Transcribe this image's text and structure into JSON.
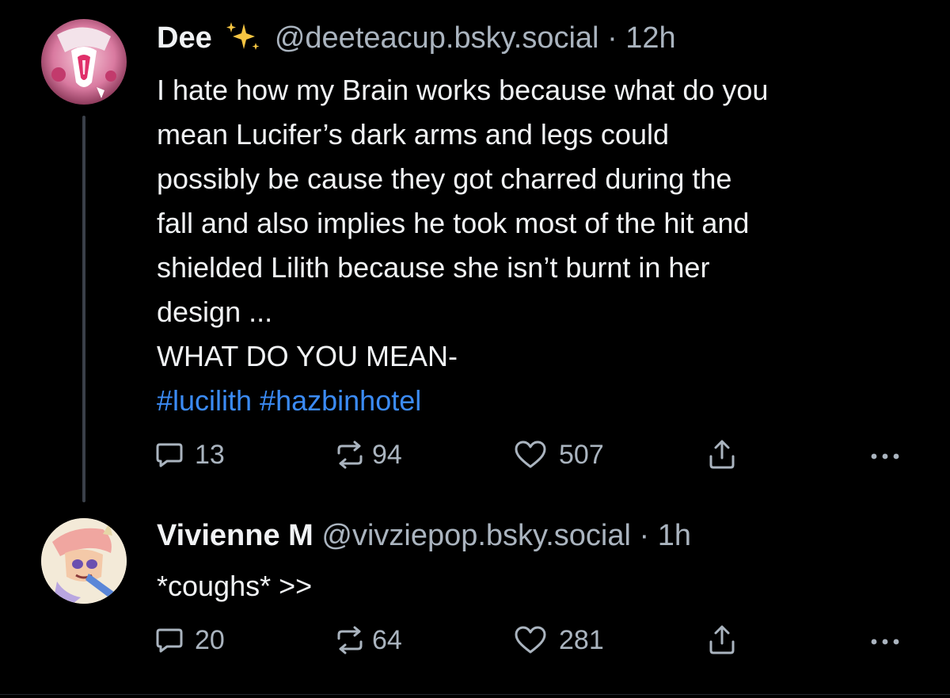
{
  "posts": [
    {
      "display_name": "Dee",
      "handle": "@deeteacup.bsky.social",
      "separator": "·",
      "time": "12h",
      "text_lines": [
        "I hate how my Brain works because what do you",
        "mean Lucifer’s dark arms and legs could",
        "possibly be cause they got charred during the",
        "fall and also implies he took most of the hit and",
        "shielded Lilith because she isn’t burnt in her",
        "design ...",
        "WHAT DO YOU MEAN-"
      ],
      "hashtags": "#lucilith #hazbinhotel",
      "replies": "13",
      "reposts": "94",
      "likes": "507",
      "icons": [
        "reply-icon",
        "repost-icon",
        "like-icon",
        "share-icon",
        "more-icon",
        "sparkles-icon"
      ]
    },
    {
      "display_name": "Vivienne M",
      "handle": "@vivziepop.bsky.social",
      "separator": "·",
      "time": "1h",
      "text_lines": [
        "*coughs* >>"
      ],
      "replies": "20",
      "reposts": "64",
      "likes": "281",
      "icons": [
        "reply-icon",
        "repost-icon",
        "like-icon",
        "share-icon",
        "more-icon"
      ]
    }
  ],
  "colors": {
    "background": "#000000",
    "text": "#f1f3f5",
    "muted": "#aab4bf",
    "hashtag": "#3b8bf5",
    "thread_line": "#3a4049",
    "sparkle": "#f5c542"
  }
}
